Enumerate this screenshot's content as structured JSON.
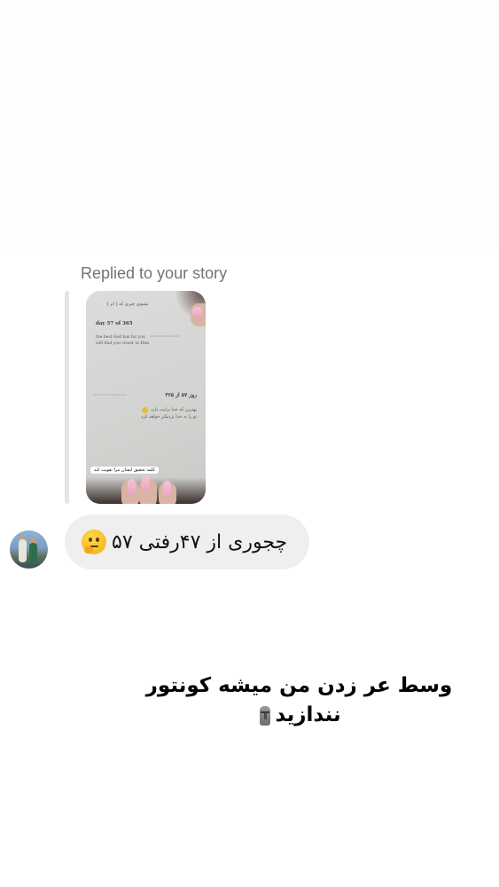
{
  "story_reply": {
    "label": "Replied to your story",
    "thumbnail": {
      "header_text": "بشنوی چیزی که [ ام ]",
      "day_en": "day 57 of 365",
      "line_en_1": "the best God has for you",
      "line_en_2": "will find you closer to Him",
      "day_fa": "روز ۵۷ از ۳۶۵",
      "line_fa_1": "بهترین که خدا برایت دارد",
      "line_fa_2": "تو را به خدا نزدیکتر خواهد کرد",
      "sticker": "کلمه تحقیق ایشان مرا تقویت کند"
    }
  },
  "message": {
    "text": "چجوری از ۴۷رفتی ۵۷",
    "emoji": "thinking-face-emoji"
  },
  "caption": {
    "line1": "وسط عر زدن من میشه کونتور",
    "line2": "نندازید",
    "emoji": "moai-emoji"
  },
  "colors": {
    "bubble_bg": "#efefef",
    "label_gray": "#737373",
    "reply_bar": "#e4e4e6"
  }
}
